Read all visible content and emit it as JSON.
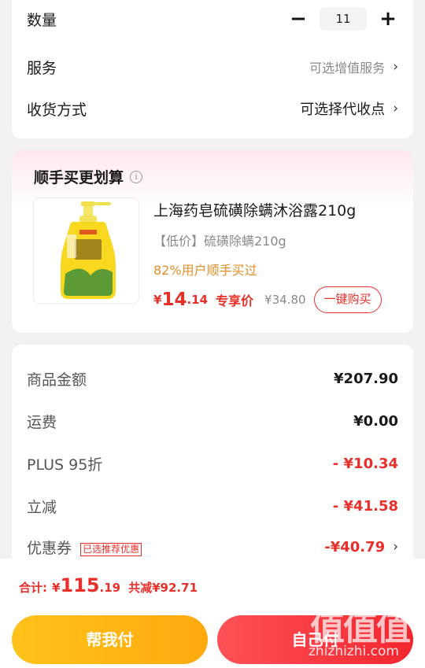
{
  "order": {
    "quantity": {
      "label": "数量",
      "value": "11",
      "minus": "−",
      "plus": "+"
    },
    "service": {
      "label": "服务",
      "value": "可选增值服务"
    },
    "delivery": {
      "label": "收货方式",
      "value": "可选择代收点"
    },
    "chevron": "›"
  },
  "addon": {
    "title": "顺手买更划算",
    "info": "i",
    "product": {
      "name": "上海药皂硫磺除螨沐浴露210g",
      "tag_line": "【低价】硫磺除螨210g",
      "stat": "82%用户顺手买过",
      "price_yen": "¥",
      "price_int": "14",
      "price_dec": ".14",
      "price_tag": "专享价",
      "old_price": "¥34.80",
      "buy_label": "一键购买",
      "bottle_text": "硫磺除螨",
      "brand_text": "上海药皂"
    }
  },
  "summary": {
    "rows": [
      {
        "label": "商品金额",
        "value": "¥207.90"
      },
      {
        "label": "运费",
        "value": "¥0.00"
      },
      {
        "label": "PLUS 95折",
        "value": "- ¥10.34"
      },
      {
        "label": "立减",
        "value": "- ¥41.58"
      },
      {
        "label": "优惠券",
        "badge": "已选推荐优惠",
        "value": "-¥40.79"
      }
    ]
  },
  "footer": {
    "total_label": "合计:",
    "total_yen": "¥",
    "total_int": "115",
    "total_dec": ".19",
    "discount": "共减¥92.71",
    "help_pay": "帮我付",
    "self_pay": "自己付"
  },
  "watermark": {
    "big": "值值值",
    "small": "zhizhizhi.com"
  },
  "colors": {
    "accent_red": "#e8302b",
    "orange_text": "#e0902a",
    "help_btn": "#ffb814",
    "self_btn": "#f73b42"
  }
}
